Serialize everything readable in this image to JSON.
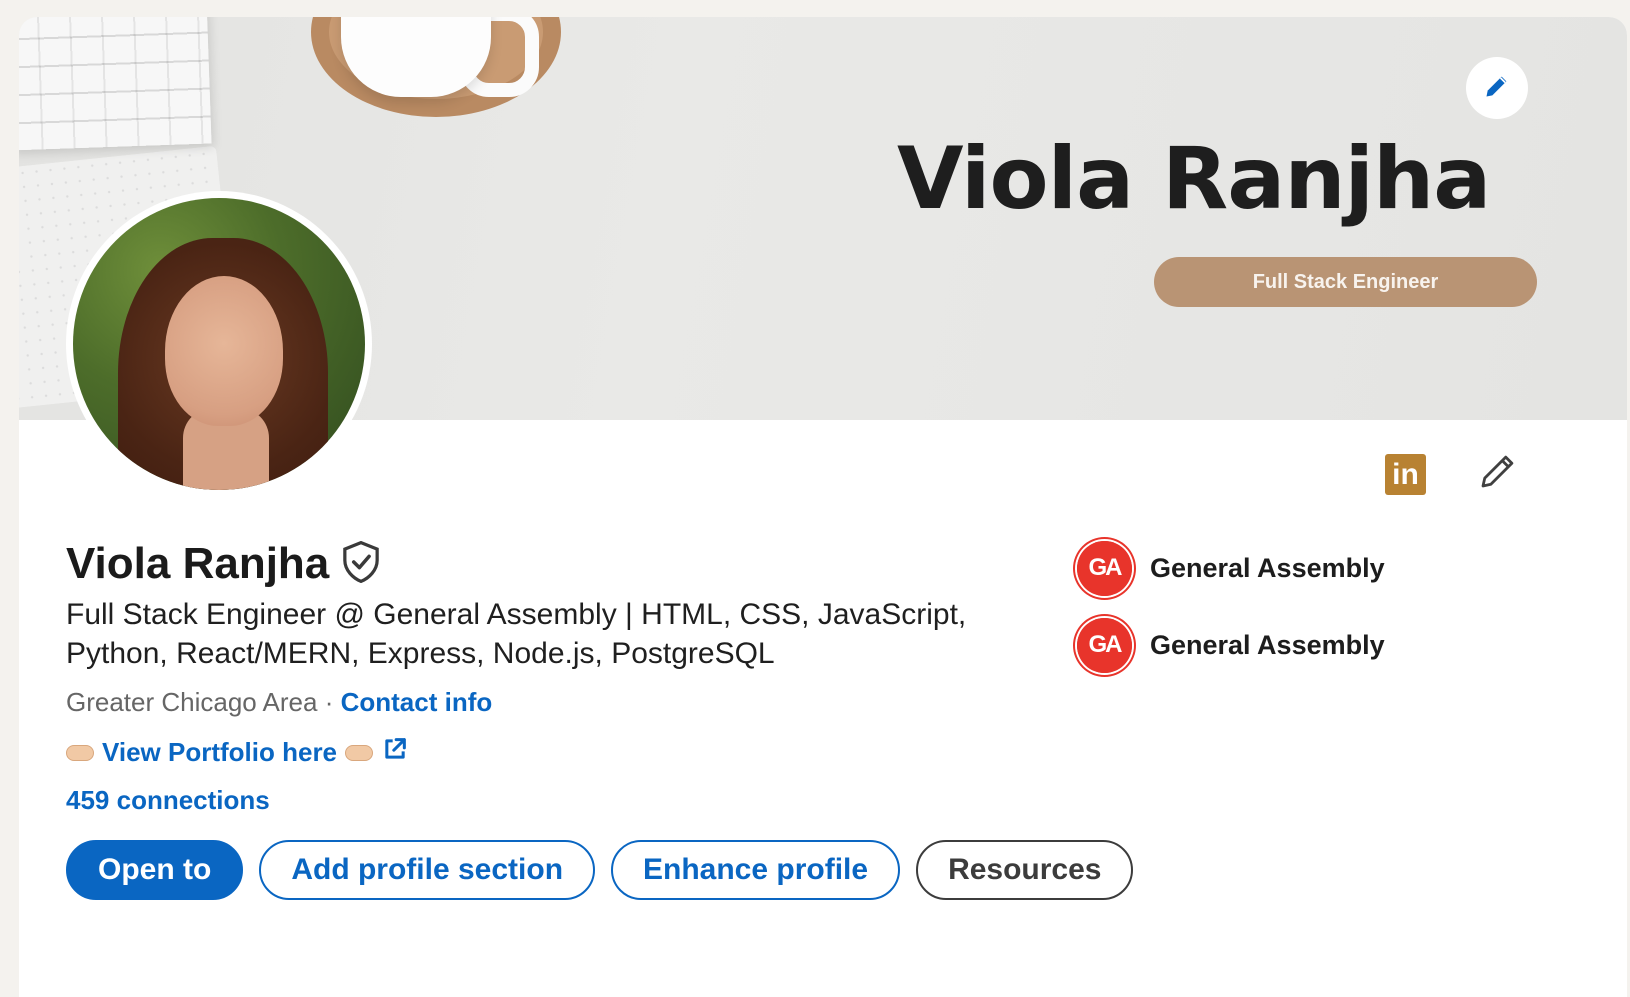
{
  "banner": {
    "name": "Viola Ranjha",
    "pill": "Full Stack Engineer"
  },
  "profile": {
    "name": "Viola Ranjha",
    "headline": "Full Stack Engineer @ General Assembly | HTML, CSS, JavaScript, Python, React/MERN, Express, Node.js, PostgreSQL",
    "location": "Greater Chicago Area",
    "separator": "·",
    "contact_info": "Contact info",
    "portfolio_link": "View Portfolio here",
    "connections": "459 connections"
  },
  "linkedin_badge": "in",
  "education": [
    {
      "logo": "GA",
      "name": "General Assembly"
    },
    {
      "logo": "GA",
      "name": "General Assembly"
    }
  ],
  "buttons": {
    "open_to": "Open to",
    "add_section": "Add profile section",
    "enhance": "Enhance profile",
    "resources": "Resources"
  },
  "colors": {
    "accent": "#0a66c2",
    "ga_red": "#e8342b",
    "linkedin_gold": "#b88232"
  },
  "icons": [
    "pencil-icon",
    "verified-shield-icon",
    "external-link-icon",
    "linkedin-icon",
    "pointing-hand-icon"
  ]
}
